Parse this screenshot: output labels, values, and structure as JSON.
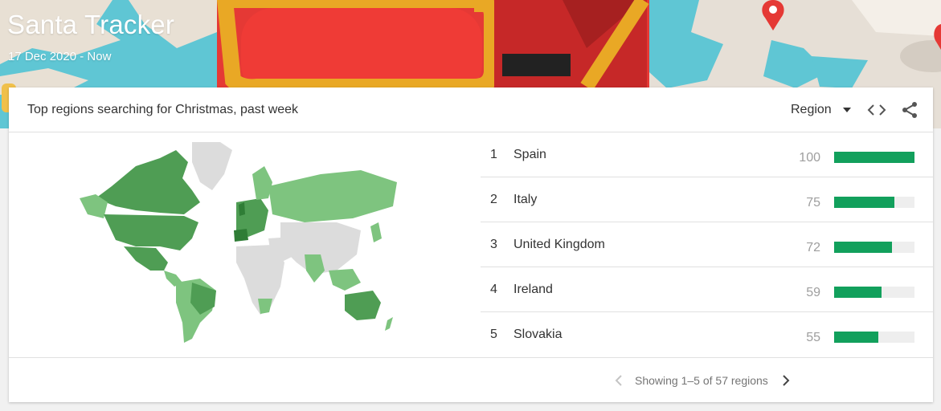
{
  "banner": {
    "title": "Santa Tracker",
    "date_range": "17 Dec 2020 - Now"
  },
  "card": {
    "title": "Top regions searching for Christmas, past week",
    "region_select": "Region",
    "regions": [
      {
        "rank": "1",
        "name": "Spain",
        "value": 100
      },
      {
        "rank": "2",
        "name": "Italy",
        "value": 75
      },
      {
        "rank": "3",
        "name": "United Kingdom",
        "value": 72
      },
      {
        "rank": "4",
        "name": "Ireland",
        "value": 59
      },
      {
        "rank": "5",
        "name": "Slovakia",
        "value": 55
      }
    ],
    "pagination": "Showing 1–5 of 57 regions"
  },
  "icons": {
    "region_dropdown": "caret-down-icon",
    "embed": "embed-code-icon",
    "share": "share-icon",
    "prev": "chevron-left-icon",
    "next": "chevron-right-icon"
  },
  "colors": {
    "bar": "#12a05c",
    "map_dark": "#4f9d54",
    "map_light": "#7ec47f",
    "map_none": "#dcdcdc"
  }
}
